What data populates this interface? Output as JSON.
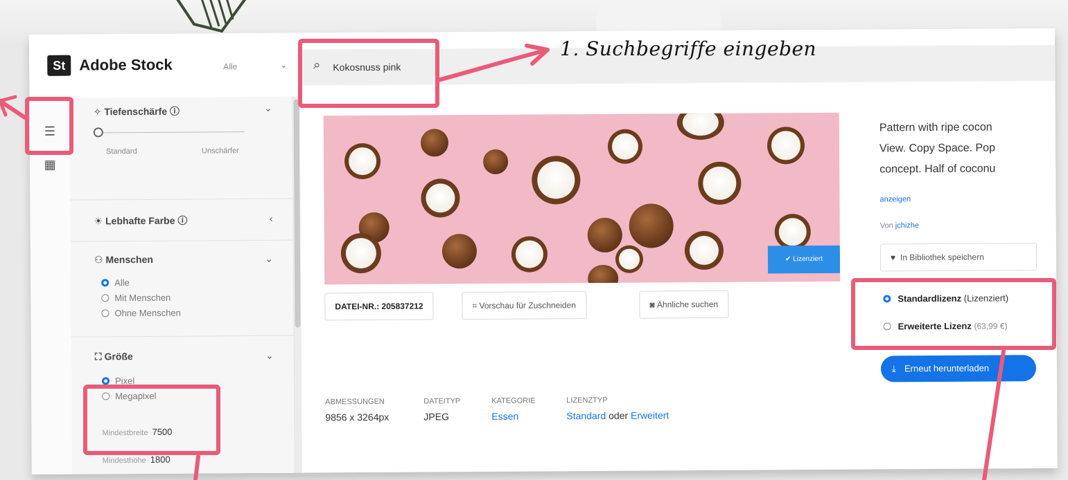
{
  "annotation": {
    "search_hint": "1. Suchbegriffe eingeben",
    "accent_color": "#e85c79"
  },
  "header": {
    "logo_short": "St",
    "brand": "Adobe Stock",
    "type_select": "Alle",
    "search_value": "Kokosnuss pink"
  },
  "rail": {
    "icons": [
      "filter-icon",
      "collection-icon"
    ]
  },
  "filters": {
    "depth": {
      "title": "Tiefenschärfe",
      "min_label": "Standard",
      "max_label": "Unschärfer"
    },
    "vivid": {
      "title": "Lebhafte Farbe"
    },
    "people": {
      "title": "Menschen",
      "options": [
        "Alle",
        "Mit Menschen",
        "Ohne Menschen"
      ],
      "selected": "Alle"
    },
    "size": {
      "title": "Größe",
      "options": [
        "Pixel",
        "Megapixel"
      ],
      "selected": "Pixel",
      "min_width_label": "Mindestbreite",
      "min_width_value": "7500",
      "min_height_label": "Mindesthöhe",
      "min_height_value": "1800"
    }
  },
  "asset": {
    "licensed_badge": "Lizenziert",
    "file_nr_label": "DATEI-NR.:",
    "file_nr_value": "205837212",
    "crop_preview": "Vorschau für Zuschneiden",
    "find_similar": "Ähnliche suchen",
    "meta": {
      "dim_label": "ABMESSUNGEN",
      "dim_value": "9856 x 3264px",
      "type_label": "DATEITYP",
      "type_value": "JPEG",
      "category_label": "KATEGORIE",
      "category_value": "Essen",
      "license_label": "LIZENZTYP",
      "license_std": "Standard",
      "license_or": "oder",
      "license_ext": "Erweitert"
    }
  },
  "details": {
    "desc_line1": "Pattern with ripe cocon",
    "desc_line2": "View. Copy Space. Pop",
    "desc_line3": "concept. Half of coconu",
    "show_more": "anzeigen",
    "author_prefix": "Von",
    "author": "jchizhe",
    "save_button": "In Bibliothek speichern",
    "license_standard": "Standardlizenz",
    "license_standard_note": "(Lizenziert)",
    "license_extended": "Erweiterte Lizenz",
    "license_extended_price": "(63,99 €)",
    "license_selected": "Standardlizenz",
    "download_button": "Erneut herunterladen",
    "accent_color": "#1473e6"
  }
}
